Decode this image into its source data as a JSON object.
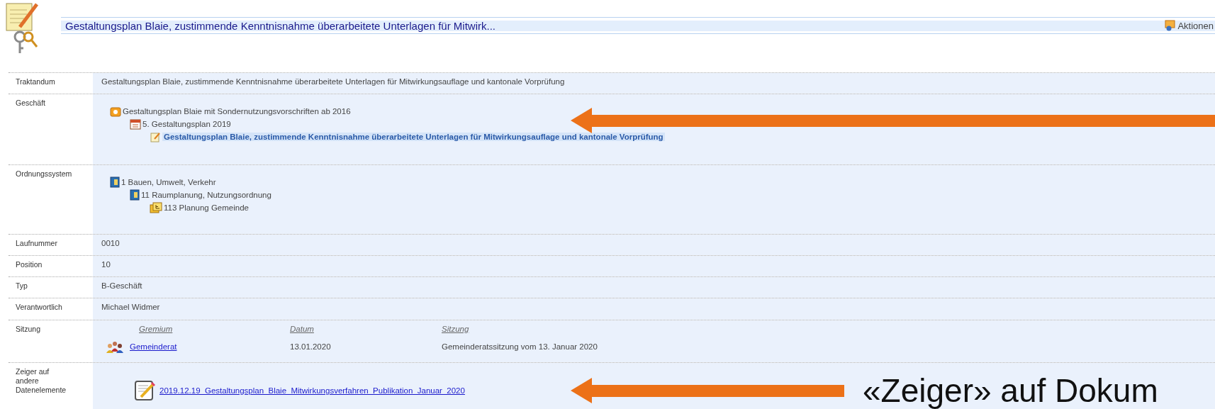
{
  "header": {
    "title": "Gestaltungsplan Blaie, zustimmende Kenntnisnahme überarbeitete Unterlagen für Mitwirk...",
    "actions_label": "Aktionen"
  },
  "fields": [
    {
      "kind": "text",
      "label": "Traktandum",
      "value": "Gestaltungsplan Blaie, zustimmende Kenntnisnahme überarbeitete Unterlagen für Mitwirkungsauflage und kantonale Vorprüfung"
    },
    {
      "kind": "tree",
      "label": "Geschäft",
      "annotation": {
        "kind": "arrow"
      },
      "nodes": [
        {
          "kind": "dossier",
          "text": "Gestaltungsplan Blaie mit Sondernutzungsvorschriften ab 2016",
          "selected": false,
          "children": [
            {
              "kind": "calendar",
              "text": "5. Gestaltungsplan 2019",
              "selected": false,
              "children": [
                {
                  "kind": "agenda-item",
                  "text": "Gestaltungsplan Blaie, zustimmende Kenntnisnahme überarbeitete Unterlagen für Mitwirkungsauflage und kantonale Vorprüfung",
                  "selected": true
                }
              ]
            }
          ]
        }
      ]
    },
    {
      "kind": "tree",
      "label": "Ordnungssystem",
      "nodes": [
        {
          "kind": "binder",
          "text": "1 Bauen, Umwelt, Verkehr",
          "selected": false,
          "children": [
            {
              "kind": "binder",
              "text": "11 Raumplanung, Nutzungsordnung",
              "selected": false,
              "children": [
                {
                  "kind": "register",
                  "text": "113 Planung Gemeinde",
                  "selected": false
                }
              ]
            }
          ]
        }
      ]
    },
    {
      "kind": "text",
      "label": "Laufnummer",
      "value": "0010"
    },
    {
      "kind": "text",
      "label": "Position",
      "value": "10"
    },
    {
      "kind": "text",
      "label": "Typ",
      "value": "B-Geschäft"
    },
    {
      "kind": "text",
      "label": "Verantwortlich",
      "value": "Michael Widmer"
    },
    {
      "kind": "table",
      "label": "Sitzung",
      "columns": [
        "Gremium",
        "Datum",
        "Sitzung"
      ],
      "rows": [
        {
          "cells": [
            "Gemeinderat",
            "13.01.2020",
            "Gemeinderatssitzung vom 13. Januar 2020"
          ]
        }
      ]
    },
    {
      "kind": "links",
      "label": "Zeiger auf andere Datenelemente",
      "annotation": {
        "kind": "arrow",
        "caption": "«Zeiger» auf Dokum"
      },
      "links": [
        "2019.12.19_Gestaltungsplan_Blaie_Mitwirkungsverfahren_Publikation_Januar_2020"
      ]
    }
  ]
}
